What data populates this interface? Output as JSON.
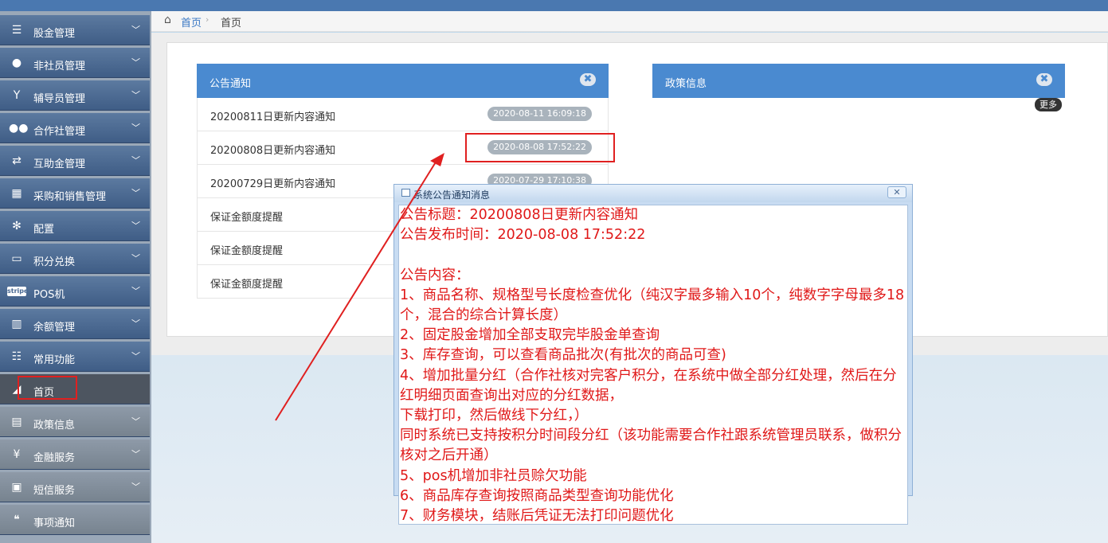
{
  "sidebar": {
    "items": [
      {
        "label": "股金管理",
        "icon": "database-icon"
      },
      {
        "label": "非社员管理",
        "icon": "person-icon"
      },
      {
        "label": "辅导员管理",
        "icon": "person-wave-icon"
      },
      {
        "label": "合作社管理",
        "icon": "group-icon"
      },
      {
        "label": "互助金管理",
        "icon": "retweet-icon"
      },
      {
        "label": "采购和销售管理",
        "icon": "building-icon"
      },
      {
        "label": "配置",
        "icon": "gears-icon"
      },
      {
        "label": "积分兑换",
        "icon": "credit-card-icon"
      },
      {
        "label": "POS机",
        "icon": "stripe-icon",
        "icon_text": "stripe"
      },
      {
        "label": "余额管理",
        "icon": "building-icon"
      },
      {
        "label": "常用功能",
        "icon": "server-icon"
      },
      {
        "label": "首页",
        "icon": "eraser-icon"
      },
      {
        "label": "政策信息",
        "icon": "newspaper-icon"
      },
      {
        "label": "金融服务",
        "icon": "yen-icon",
        "icon_text": "¥"
      },
      {
        "label": "短信服务",
        "icon": "archive-icon"
      },
      {
        "label": "事项通知",
        "icon": "comments-icon"
      }
    ]
  },
  "breadcrumb": {
    "home": "首页",
    "current": "首页",
    "separator": "›"
  },
  "notice_panel": {
    "title": "公告通知",
    "close": "✖",
    "rows": [
      {
        "title": "20200811日更新内容通知",
        "date": "2020-08-11 16:09:18"
      },
      {
        "title": "20200808日更新内容通知",
        "date": "2020-08-08 17:52:22"
      },
      {
        "title": "20200729日更新内容通知",
        "date": "2020-07-29 17:10:38"
      },
      {
        "title": "保证金额度提醒",
        "date": ""
      },
      {
        "title": "保证金额度提醒",
        "date": ""
      },
      {
        "title": "保证金额度提醒",
        "date": ""
      }
    ]
  },
  "policy_panel": {
    "title": "政策信息",
    "close": "✖",
    "more": "更多"
  },
  "dialog": {
    "title": "系统公告通知消息",
    "close": "✕",
    "body": "公告标题：20200808日更新内容通知\n公告发布时间：2020-08-08 17:52:22\n\n公告内容：\n1、商品名称、规格型号长度检查优化（纯汉字最多输入10个，纯数字字母最多18个，混合的综合计算长度）\n2、固定股金增加全部支取完毕股金单查询\n3、库存查询，可以查看商品批次(有批次的商品可查)\n4、增加批量分红（合作社核对完客户积分，在系统中做全部分红处理，然后在分红明细页面查询出对应的分红数据，\n下载打印，然后做线下分红，）\n同时系统已支持按积分时间段分红（该功能需要合作社跟系统管理员联系，做积分核对之后开通）\n5、pos机增加非社员赊欠功能\n6、商品库存查询按照商品类型查询功能优化\n7、财务模块，结账后凭证无法打印问题优化"
  },
  "colors": {
    "accent": "#4a8ad0",
    "annotation": "#e02020",
    "dialog_text": "#e01818"
  }
}
